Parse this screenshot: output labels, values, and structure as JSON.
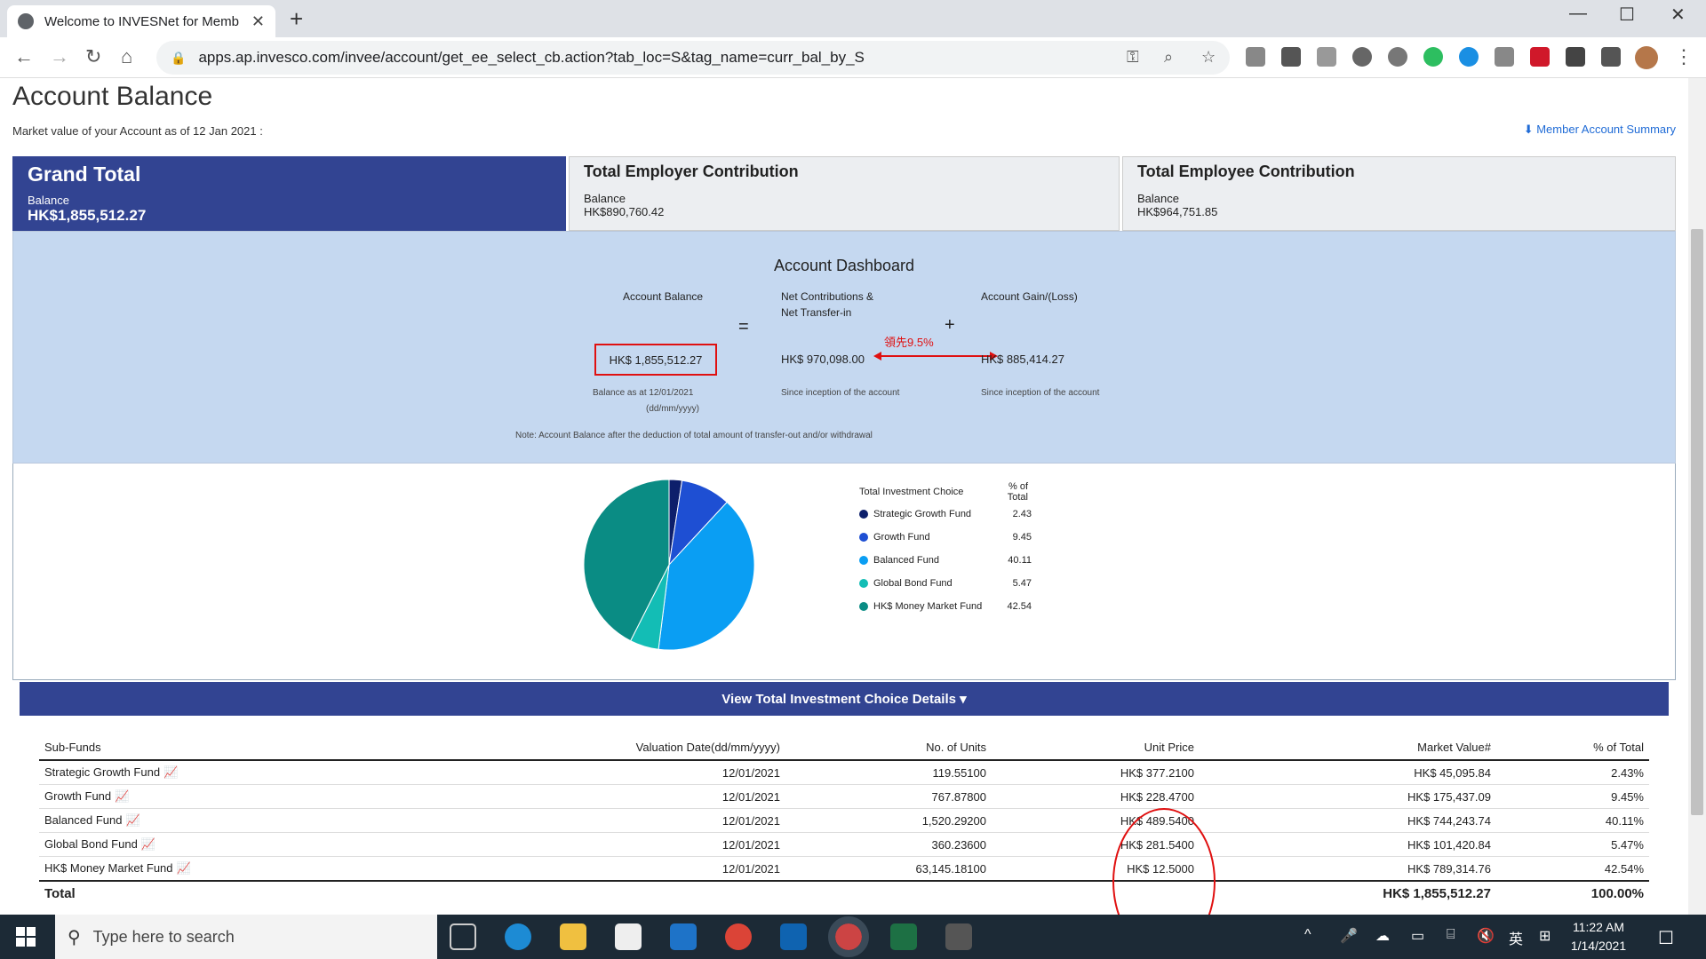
{
  "browser": {
    "tab_title": "Welcome to INVESNet for Memb",
    "tab_close": "✕",
    "new_tab": "+",
    "url": "apps.ap.invesco.com/invee/account/get_ee_select_cb.action?tab_loc=S&tag_name=curr_bal_by_S",
    "window_controls": {
      "minimize": "—",
      "maximize": "☐",
      "close": "✕"
    },
    "icons": [
      "back-arrow-icon",
      "forward-arrow-icon",
      "reload-icon",
      "home-icon",
      "lock-icon",
      "key-icon",
      "zoom-icon",
      "star-icon",
      "extensions-icon"
    ]
  },
  "page": {
    "title": "Account Balance",
    "market_value_note": "Market value of your Account as of 12 Jan 2021 :",
    "member_summary_link": "Member Account Summary",
    "cards": [
      {
        "title": "Grand Total",
        "label": "Balance",
        "value": "HK$1,855,512.27"
      },
      {
        "title": "Total Employer Contribution",
        "label": "Balance",
        "value": "HK$890,760.42"
      },
      {
        "title": "Total Employee Contribution",
        "label": "Balance",
        "value": "HK$964,751.85"
      }
    ],
    "dashboard": {
      "title": "Account Dashboard",
      "account_balance_label": "Account Balance",
      "account_balance_value": "HK$ 1,855,512.27",
      "balance_as_at": "Balance as at 12/01/2021",
      "date_format": "(dd/mm/yyyy)",
      "equals": "=",
      "plus": "+",
      "net_contrib_label_1": "Net Contributions &",
      "net_contrib_label_2": "Net Transfer-in",
      "net_contrib_value": "HK$ 970,098.00",
      "net_contrib_since": "Since inception of the account",
      "gain_label": "Account Gain/(Loss)",
      "gain_value": "HK$ 885,414.27",
      "gain_since": "Since inception of the account",
      "annotation": "領先9.5%",
      "note": "Note: Account Balance after the deduction of total amount of transfer-out and/or withdrawal"
    },
    "view_details_button": "View Total Investment Choice Details ▾",
    "table": {
      "headers": [
        "Sub-Funds",
        "Valuation Date(dd/mm/yyyy)",
        "No. of Units",
        "Unit Price",
        "Market Value#",
        "% of Total"
      ],
      "rows": [
        [
          "Strategic Growth Fund",
          "12/01/2021",
          "119.55100",
          "HK$ 377.2100",
          "HK$ 45,095.84",
          "2.43%"
        ],
        [
          "Growth Fund",
          "12/01/2021",
          "767.87800",
          "HK$ 228.4700",
          "HK$ 175,437.09",
          "9.45%"
        ],
        [
          "Balanced Fund",
          "12/01/2021",
          "1,520.29200",
          "HK$ 489.5400",
          "HK$ 744,243.74",
          "40.11%"
        ],
        [
          "Global Bond Fund",
          "12/01/2021",
          "360.23600",
          "HK$ 281.5400",
          "HK$ 101,420.84",
          "5.47%"
        ],
        [
          "HK$ Money Market Fund",
          "12/01/2021",
          "63,145.18100",
          "HK$ 12.5000",
          "HK$ 789,314.76",
          "42.54%"
        ]
      ],
      "total_label": "Total",
      "total_value": "HK$ 1,855,512.27",
      "total_pct": "100.00%"
    }
  },
  "chart_data": {
    "type": "pie",
    "legend_header": [
      "Total Investment Choice",
      "% of Total"
    ],
    "categories": [
      "Strategic Growth Fund",
      "Growth Fund",
      "Balanced Fund",
      "Global Bond Fund",
      "HK$ Money Market Fund"
    ],
    "values": [
      2.43,
      9.45,
      40.11,
      5.47,
      42.54
    ],
    "colors": [
      "#0d1f6b",
      "#1e4fd3",
      "#0a9ef3",
      "#13bdb5",
      "#0a8c84"
    ],
    "legend_placement": "right"
  },
  "taskbar": {
    "search_placeholder": "Type here to search",
    "lang": "英",
    "time": "11:22 AM",
    "date": "1/14/2021"
  }
}
